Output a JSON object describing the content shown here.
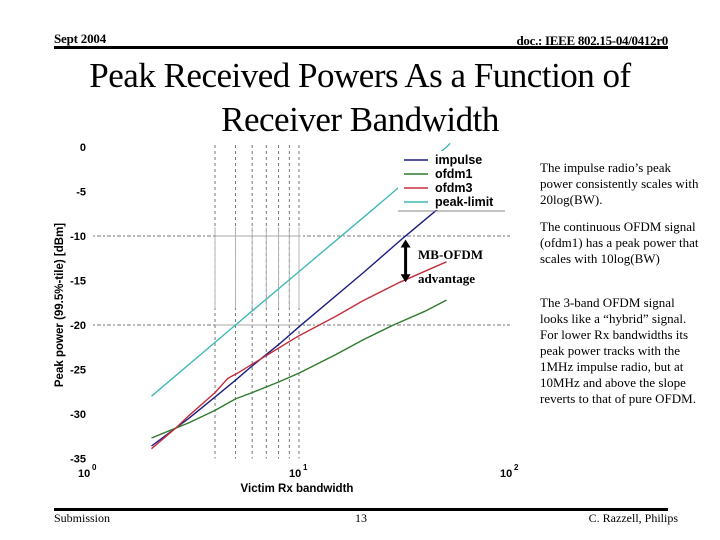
{
  "header": {
    "date": "Sept 2004",
    "doc_id": "doc.: IEEE 802.15-04/0412r0"
  },
  "title": {
    "line1": "Peak Received Powers As a Function of",
    "line2": "Receiver Bandwidth"
  },
  "side_notes": [
    "The impulse radio’s peak power consistently scales with 20log(BW).",
    "The continuous OFDM signal (ofdm1) has a peak power that scales with 10log(BW)",
    "The 3-band OFDM signal looks like a “hybrid” signal. For lower Rx bandwidths its peak power tracks with the 1MHz impulse radio, but at 10MHz and above the slope reverts to that of pure OFDM."
  ],
  "footer": {
    "left": "Submission",
    "page": "13",
    "author": "C. Razzell, Philips"
  },
  "chart_data": {
    "type": "line",
    "title": "",
    "xlabel": "Victim Rx bandwidth",
    "ylabel": "Peak power (99.5%-tile) [dBm]",
    "xscale": "log",
    "xlim": [
      1,
      100
    ],
    "ylim": [
      -35,
      0
    ],
    "x_ticks": [
      {
        "value": 1,
        "base": "10",
        "exp": "0"
      },
      {
        "value": 10,
        "base": "10",
        "exp": "1"
      },
      {
        "value": 100,
        "base": "10",
        "exp": "2"
      }
    ],
    "y_ticks": [
      0,
      -5,
      -10,
      -15,
      -20,
      -25,
      -30,
      -35
    ],
    "grid": {
      "x_minor": [
        4,
        5,
        6,
        7,
        8,
        9,
        10
      ],
      "y": [
        -10,
        -20
      ]
    },
    "legend_position": "top-right",
    "series": [
      {
        "name": "impulse",
        "color": "#1c1c82",
        "points": [
          [
            2,
            -33.6
          ],
          [
            3,
            -30.5
          ],
          [
            4,
            -28.1
          ],
          [
            5,
            -26.2
          ],
          [
            6,
            -24.6
          ],
          [
            8,
            -22.2
          ],
          [
            10,
            -20.2
          ],
          [
            20,
            -14.2
          ],
          [
            31.6,
            -10.1
          ],
          [
            47,
            -6.7
          ]
        ]
      },
      {
        "name": "ofdm1",
        "color": "#2f7a2f",
        "points": [
          [
            2,
            -32.7
          ],
          [
            2.6,
            -31.6
          ],
          [
            3,
            -31.0
          ],
          [
            4,
            -29.6
          ],
          [
            5,
            -28.3
          ],
          [
            6,
            -27.6
          ],
          [
            8,
            -26.4
          ],
          [
            10,
            -25.4
          ],
          [
            15,
            -23.3
          ],
          [
            20,
            -21.7
          ],
          [
            28,
            -20.0
          ],
          [
            40,
            -18.4
          ],
          [
            50,
            -17.2
          ]
        ]
      },
      {
        "name": "ofdm3",
        "color": "#c2303c",
        "points": [
          [
            2,
            -33.9
          ],
          [
            2.6,
            -31.6
          ],
          [
            3,
            -30.2
          ],
          [
            4,
            -27.6
          ],
          [
            4.6,
            -26.0
          ],
          [
            5.2,
            -25.3
          ],
          [
            6,
            -24.4
          ],
          [
            8,
            -22.6
          ],
          [
            10,
            -21.2
          ],
          [
            15,
            -19.0
          ],
          [
            20,
            -17.3
          ],
          [
            30,
            -15.2
          ],
          [
            50,
            -12.9
          ]
        ]
      },
      {
        "name": "peak-limit",
        "color": "#3fb8b8",
        "points": [
          [
            2,
            -28.0
          ],
          [
            5,
            -20.0
          ],
          [
            10,
            -14.0
          ],
          [
            20,
            -8.0
          ],
          [
            50,
            0.0
          ],
          [
            52,
            0.4
          ]
        ]
      }
    ],
    "annotations": [
      {
        "text": "MB-OFDM",
        "type": "label"
      },
      {
        "text": "advantage",
        "type": "label"
      },
      {
        "type": "double-arrow",
        "x": 32,
        "y_from": -10.4,
        "y_to": -15.2
      }
    ]
  }
}
